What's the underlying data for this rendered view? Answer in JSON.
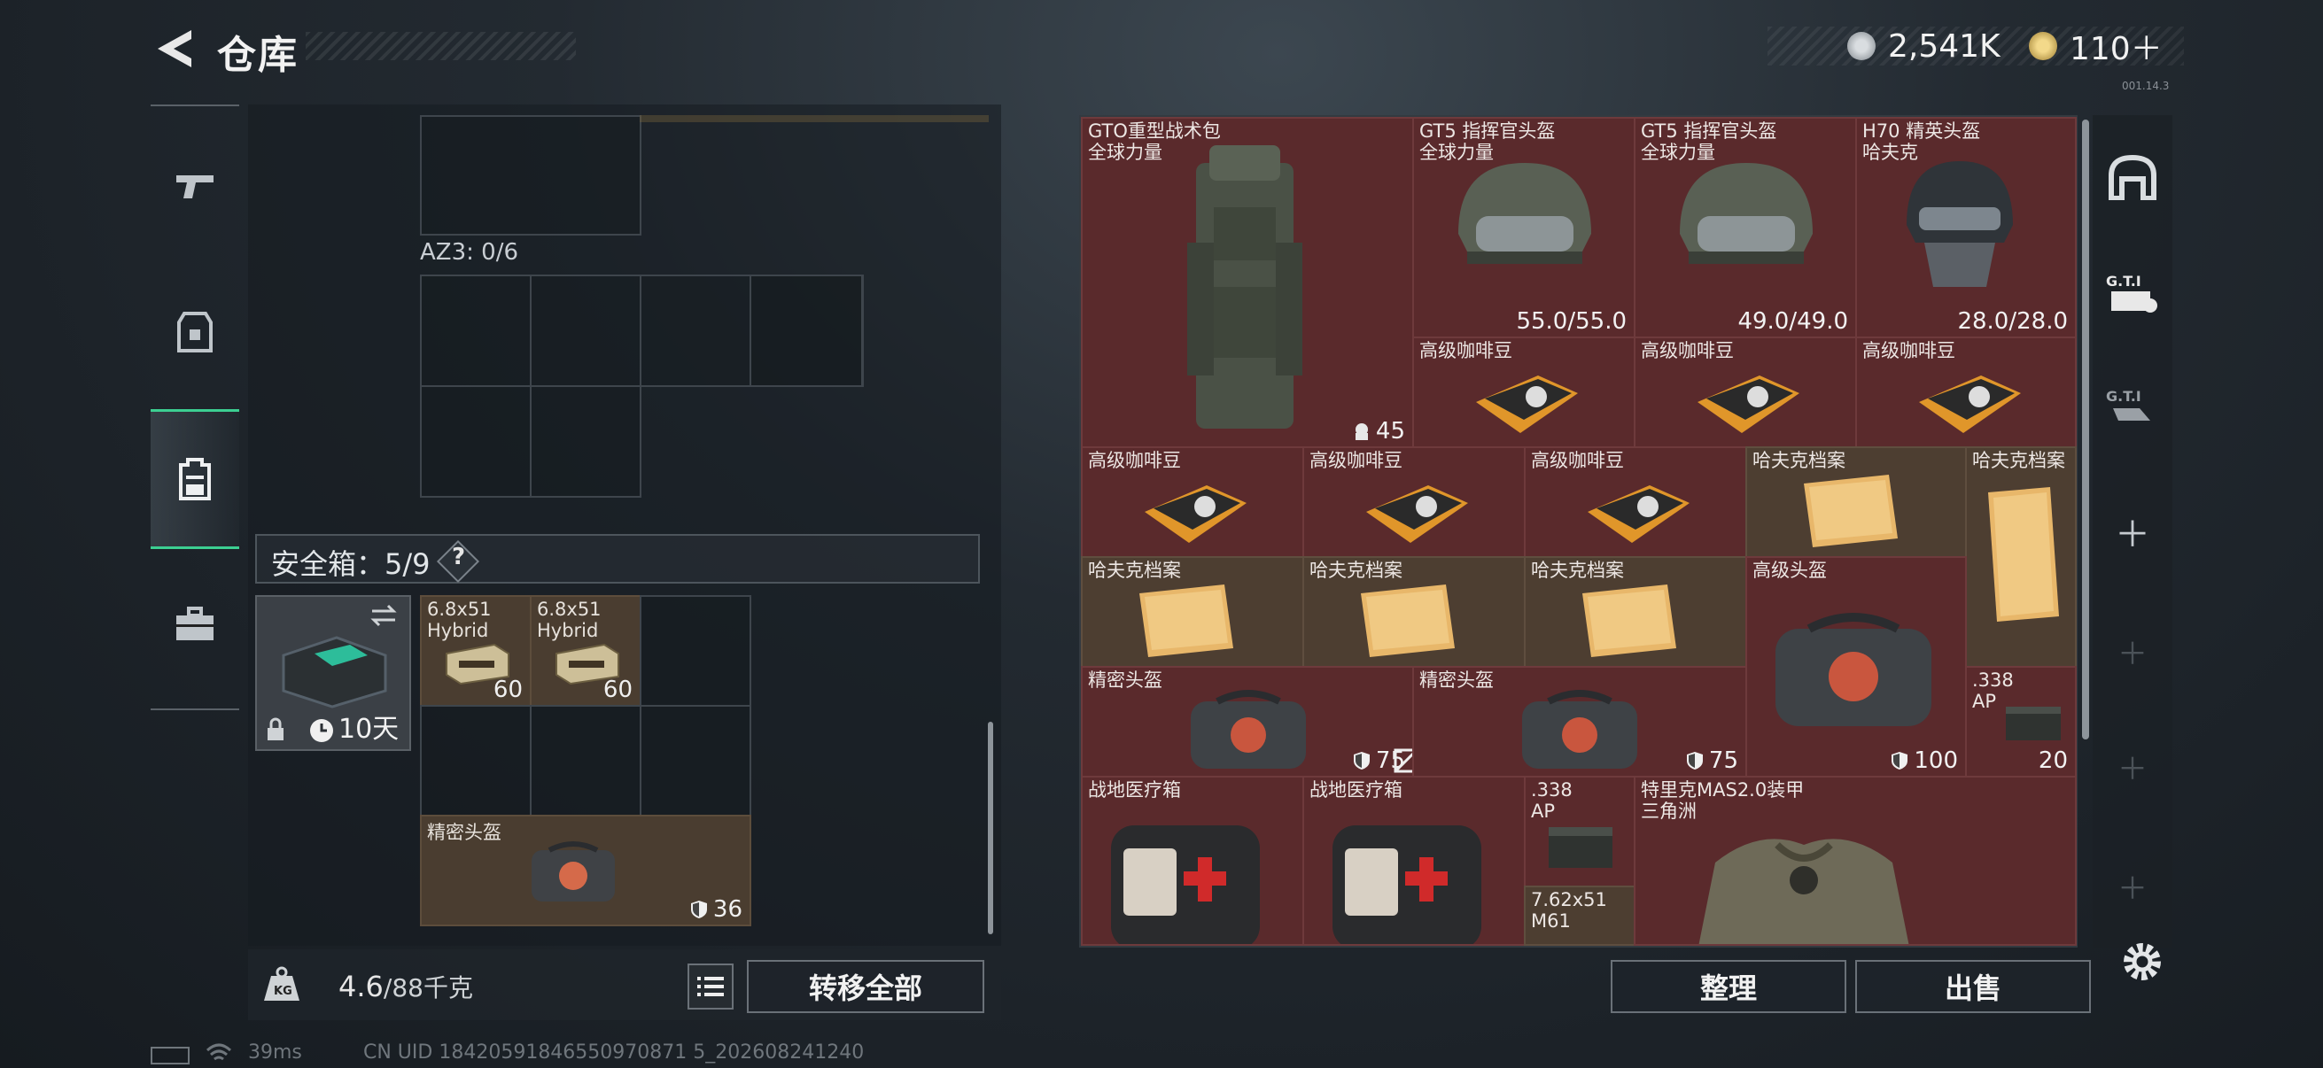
{
  "header": {
    "title": "仓库",
    "currency_a": "2,541K",
    "currency_b": "110＋",
    "version": "001.14.3"
  },
  "sidebar": {
    "items": [
      "weapon",
      "armor",
      "backpack",
      "case"
    ]
  },
  "left": {
    "az_label": "AZ3: 0/6",
    "safe_label": "安全箱：5/9",
    "safe_q": "?",
    "safe_timer": "10天",
    "ammo1": {
      "name": "6.8x51\nHybrid",
      "qty": "60"
    },
    "ammo2": {
      "name": "6.8x51\nHybrid",
      "qty": "60"
    },
    "helmet_bag": {
      "name": "精密头盔",
      "durability": "36"
    }
  },
  "weight": {
    "value": "4.6",
    "unit": "/88千克"
  },
  "buttons": {
    "transfer_all": "转移全部",
    "sort": "整理",
    "sell": "出售"
  },
  "items": [
    {
      "id": "backpack",
      "name": "GTO重型战术包\n全球力量",
      "value": "45",
      "icon": "lock-bag-icon"
    },
    {
      "id": "helmet1",
      "name": "GT5 指挥官头盔\n全球力量",
      "value": "55.0/55.0"
    },
    {
      "id": "helmet2",
      "name": "GT5 指挥官头盔\n全球力量",
      "value": "49.0/49.0"
    },
    {
      "id": "helmet3",
      "name": "H70 精英头盔\n哈夫克",
      "value": "28.0/28.0"
    },
    {
      "id": "coffee1",
      "name": "高级咖啡豆"
    },
    {
      "id": "coffee2",
      "name": "高级咖啡豆"
    },
    {
      "id": "coffee3",
      "name": "高级咖啡豆"
    },
    {
      "id": "coffee4",
      "name": "高级咖啡豆"
    },
    {
      "id": "coffee5",
      "name": "高级咖啡豆"
    },
    {
      "id": "coffee6",
      "name": "高级咖啡豆"
    },
    {
      "id": "file1",
      "name": "哈夫克档案"
    },
    {
      "id": "file2",
      "name": "哈夫克档案"
    },
    {
      "id": "file3",
      "name": "哈夫克档案"
    },
    {
      "id": "file4",
      "name": "哈夫克档案"
    },
    {
      "id": "file5",
      "name": "哈夫克档案"
    },
    {
      "id": "adv_helmet",
      "name": "高级头盔",
      "value": "100"
    },
    {
      "id": "prec1",
      "name": "精密头盔",
      "value": "75"
    },
    {
      "id": "prec2",
      "name": "精密头盔",
      "value": "75"
    },
    {
      "id": "ammo338a",
      "name": ".338\nAP",
      "value": "20"
    },
    {
      "id": "med1",
      "name": "战地医疗箱"
    },
    {
      "id": "med2",
      "name": "战地医疗箱"
    },
    {
      "id": "ammo338b",
      "name": ".338\nAP"
    },
    {
      "id": "ammo762",
      "name": "7.62x51\nM61"
    },
    {
      "id": "armor",
      "name": "特里克MAS2.0装甲\n三角洲"
    }
  ],
  "footer": {
    "ping": "39ms",
    "uid": "CN UID 18420591846550970871 5_202608241240"
  },
  "colors": {
    "accent": "#3ccf92",
    "item_red": "#5a2a2c",
    "item_tan": "#4d3e31"
  }
}
